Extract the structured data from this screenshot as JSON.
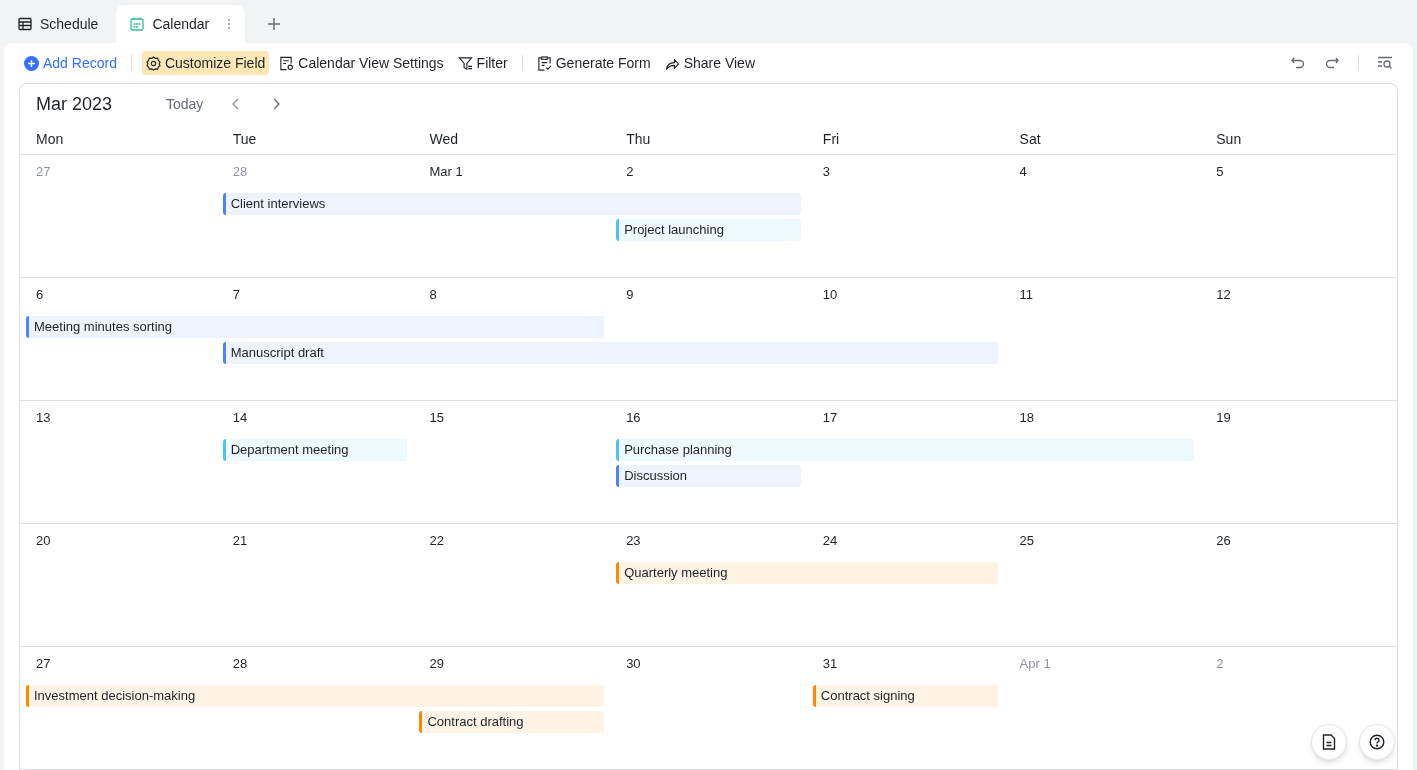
{
  "tabs": [
    {
      "label": "Schedule",
      "selected": false
    },
    {
      "label": "Calendar",
      "selected": true
    }
  ],
  "toolbar": [
    {
      "label": "Add Record",
      "kind": "primary",
      "selected": false
    },
    {
      "kind": "divider"
    },
    {
      "label": "Customize Field",
      "kind": "tool",
      "selected": true
    },
    {
      "label": "Calendar View Settings",
      "kind": "tool",
      "selected": false
    },
    {
      "label": "Filter",
      "kind": "tool",
      "selected": false
    },
    {
      "kind": "divider"
    },
    {
      "label": "Generate Form",
      "kind": "tool",
      "selected": false
    },
    {
      "label": "Share View",
      "kind": "tool",
      "selected": false
    }
  ],
  "calendar": {
    "month": "Mar 2023",
    "today_button": "Today",
    "weekdays": [
      "Mon",
      "Tue",
      "Wed",
      "Thu",
      "Fri",
      "Sat",
      "Sun"
    ],
    "weeks": [
      {
        "days": [
          {
            "label": "27",
            "in_month": false
          },
          {
            "label": "28",
            "in_month": false
          },
          {
            "label": "Mar 1",
            "in_month": true
          },
          {
            "label": "2",
            "in_month": true
          },
          {
            "label": "3",
            "in_month": true
          },
          {
            "label": "4",
            "in_month": true
          },
          {
            "label": "5",
            "in_month": true
          }
        ],
        "events": [
          {
            "title": "Client interviews",
            "color": "#4e83fd"
          },
          {
            "title": "Project launching",
            "color": "#4cc4f1"
          }
        ]
      },
      {
        "days": [
          {
            "label": "6",
            "in_month": true
          },
          {
            "label": "7",
            "in_month": true
          },
          {
            "label": "8",
            "in_month": true
          },
          {
            "label": "9",
            "in_month": true
          },
          {
            "label": "10",
            "in_month": true
          },
          {
            "label": "11",
            "in_month": true
          },
          {
            "label": "12",
            "in_month": true
          }
        ],
        "events": [
          {
            "title": "Meeting minutes sorting",
            "color": "#4e83fd"
          },
          {
            "title": "Manuscript draft",
            "color": "#4e83fd"
          }
        ]
      },
      {
        "days": [
          {
            "label": "13",
            "in_month": true
          },
          {
            "label": "14",
            "in_month": true
          },
          {
            "label": "15",
            "in_month": true
          },
          {
            "label": "16",
            "in_month": true
          },
          {
            "label": "17",
            "in_month": true
          },
          {
            "label": "18",
            "in_month": true
          },
          {
            "label": "19",
            "in_month": true
          }
        ],
        "events": [
          {
            "title": "Department meeting",
            "color": "#4cc4f1"
          },
          {
            "title": "Purchase planning",
            "color": "#4cc4f1"
          },
          {
            "title": "Discussion",
            "color": "#4e83fd"
          }
        ]
      },
      {
        "days": [
          {
            "label": "20",
            "in_month": true
          },
          {
            "label": "21",
            "in_month": true
          },
          {
            "label": "22",
            "in_month": true
          },
          {
            "label": "23",
            "in_month": true
          },
          {
            "label": "24",
            "in_month": true
          },
          {
            "label": "25",
            "in_month": true
          },
          {
            "label": "26",
            "in_month": true
          }
        ],
        "events": [
          {
            "title": "Quarterly meeting",
            "color": "#ff8800"
          }
        ]
      },
      {
        "days": [
          {
            "label": "27",
            "in_month": true
          },
          {
            "label": "28",
            "in_month": true
          },
          {
            "label": "29",
            "in_month": true
          },
          {
            "label": "30",
            "in_month": true
          },
          {
            "label": "31",
            "in_month": true
          },
          {
            "label": "Apr 1",
            "in_month": false
          },
          {
            "label": "2",
            "in_month": false
          }
        ],
        "events": [
          {
            "title": "Investment decision-making",
            "color": "#ff8800"
          },
          {
            "title": "Contract drafting",
            "color": "#ff8800"
          },
          {
            "title": "Contract signing",
            "color": "#ff8800"
          }
        ]
      }
    ]
  }
}
